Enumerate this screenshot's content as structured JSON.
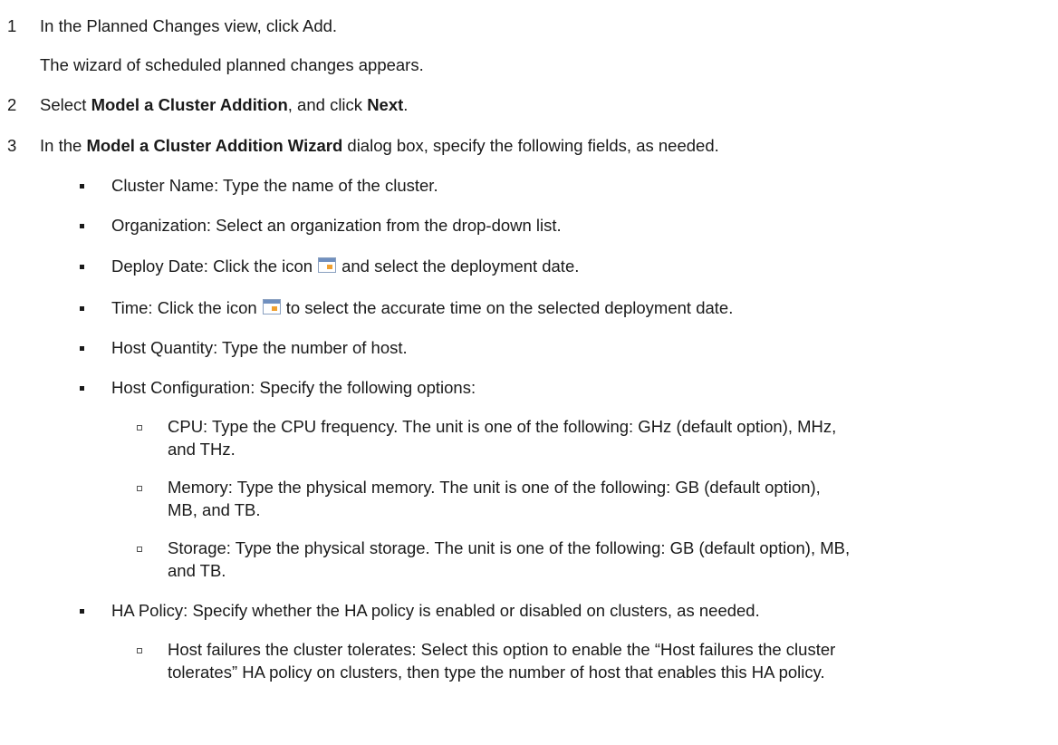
{
  "steps": [
    {
      "num": "1",
      "text": "In the Planned Changes view, click Add."
    },
    {
      "result": "The wizard of scheduled planned changes appears."
    },
    {
      "num": "2",
      "pre": "Select ",
      "b1": "Model a Cluster Addition",
      "mid": ", and click ",
      "b2": "Next",
      "post": "."
    },
    {
      "num": "3",
      "pre": "In the ",
      "b1": "Model a Cluster Addition Wizard",
      "post": " dialog box, specify the following fields, as needed."
    }
  ],
  "fields": {
    "cluster_name": "Cluster Name: Type the name of the cluster.",
    "organization": "Organization: Select an organization from the drop-down list.",
    "deploy_date_pre": "Deploy Date: Click the icon",
    "deploy_date_post": "and select the deployment date.",
    "time_pre": "Time: Click the icon",
    "time_post": "to select the accurate time on the selected deployment date.",
    "host_quantity": "Host Quantity: Type the number of host.",
    "host_configuration": "Host Configuration: Specify the following options:",
    "cpu_l1": "CPU: Type the CPU frequency. The unit is one of the following: GHz (default option), MHz,",
    "cpu_l2": "and THz.",
    "memory_l1": "Memory: Type the physical memory. The unit is one of the following: GB (default option),",
    "memory_l2": "MB, and TB.",
    "storage_l1": "Storage: Type the physical storage. The unit is one of the following: GB (default option), MB,",
    "storage_l2": "and TB.",
    "ha_policy": "HA Policy: Specify whether the HA policy is enabled or disabled on clusters, as needed.",
    "ha_host_l1": "Host failures the cluster tolerates: Select this option to enable the “Host failures the cluster",
    "ha_host_l2": "tolerates” HA policy on clusters, then type the number of host that enables this HA policy."
  }
}
